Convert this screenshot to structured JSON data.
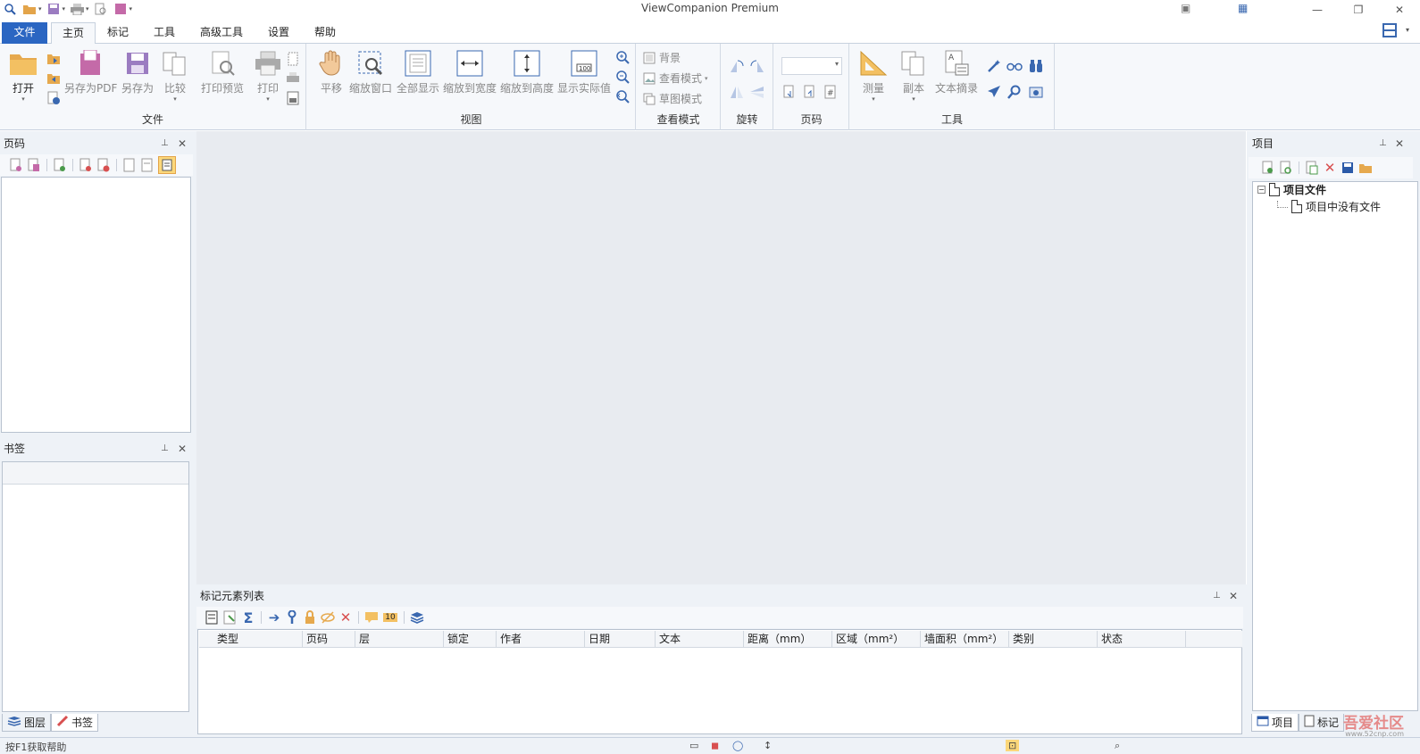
{
  "app_title": "ViewCompanion Premium",
  "tabs": {
    "file": "文件",
    "home": "主页",
    "markup": "标记",
    "tools": "工具",
    "advanced": "高级工具",
    "settings": "设置",
    "help": "帮助"
  },
  "ribbon": {
    "file_group": {
      "label": "文件",
      "open": "打开",
      "save_pdf": "另存为PDF",
      "save_as": "另存为",
      "compare": "比较",
      "print_preview": "打印预览",
      "print": "打印"
    },
    "view_group": {
      "label": "视图",
      "pan": "平移",
      "zoom_window": "缩放窗口",
      "zoom_all": "全部显示",
      "zoom_width": "缩放到宽度",
      "zoom_height": "缩放到高度",
      "actual_size": "显示实际值"
    },
    "viewmode_group": {
      "label": "查看模式",
      "background": "背景",
      "view_mode": "查看模式",
      "draft_mode": "草图模式"
    },
    "rotate_group": {
      "label": "旋转"
    },
    "page_group": {
      "label": "页码"
    },
    "tools_group": {
      "label": "工具",
      "measure": "测量",
      "copy": "副本",
      "text_extract": "文本摘录"
    }
  },
  "panels": {
    "pages": {
      "title": "页码"
    },
    "bookmarks": {
      "title": "书签"
    },
    "project": {
      "title": "项目",
      "tree_root": "项目文件",
      "tree_child": "项目中没有文件"
    },
    "markup_list": {
      "title": "标记元素列表",
      "badge": "10",
      "columns": [
        "类型",
        "页码",
        "层",
        "锁定",
        "作者",
        "日期",
        "文本",
        "距离（mm）",
        "区域（mm²）",
        "墙面积（mm²）",
        "类别",
        "状态"
      ]
    }
  },
  "left_bottom_tabs": {
    "layers": "图层",
    "bookmarks": "书签"
  },
  "right_bottom_tabs": {
    "project": "项目",
    "markup": "标记"
  },
  "status": {
    "help_text": "按F1获取帮助"
  },
  "watermark": {
    "text": "吾爱社区",
    "url": "www.52cnp.com"
  },
  "colors": {
    "accent": "#2b66c2",
    "panel_bg": "#eef2f7",
    "canvas_bg": "#e8ebf0"
  }
}
